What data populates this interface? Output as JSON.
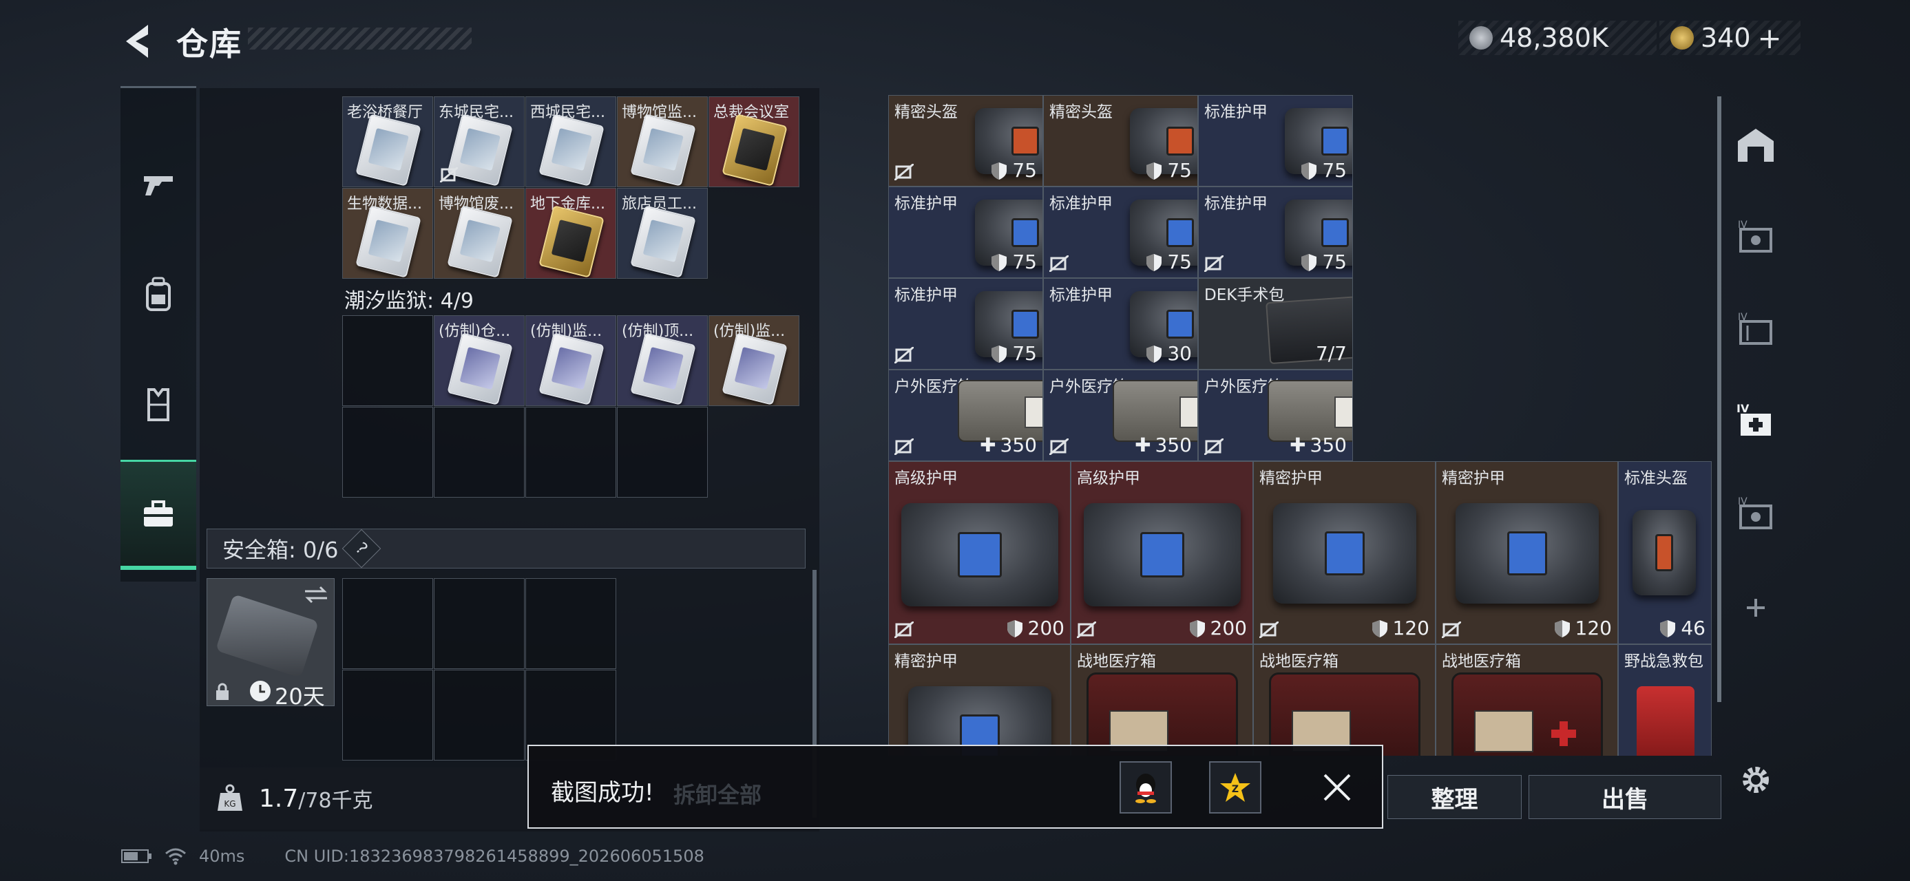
{
  "header": {
    "title": "仓库",
    "currency_1": "48,380K",
    "currency_2": "340",
    "currency_2_plus": "+"
  },
  "left_nav": [
    "gun-icon",
    "backpack-icon",
    "vest-icon",
    "toolbox-icon"
  ],
  "keycards_row1": [
    "老浴桥餐厅",
    "东城民宅...",
    "西城民宅...",
    "博物馆监...",
    "总裁会议室"
  ],
  "keycards_row2": [
    "生物数据...",
    "博物馆废...",
    "地下金库...",
    "旅店员工..."
  ],
  "prison_label": "潮汐监狱: 4/9",
  "prison_cards": [
    "(仿制)仓...",
    "(仿制)监...",
    "(仿制)顶...",
    "(仿制)监..."
  ],
  "safe": {
    "label": "安全箱: 0/6",
    "help": "?",
    "duration": "20天"
  },
  "weight": {
    "current": "1.7",
    "max": "/78千克"
  },
  "items": {
    "r1": [
      {
        "name": "精密头盔",
        "value": "75"
      },
      {
        "name": "精密头盔",
        "value": "75"
      },
      {
        "name": "标准护甲",
        "value": "75"
      }
    ],
    "r2": [
      {
        "name": "标准护甲",
        "value": "75"
      },
      {
        "name": "标准护甲",
        "value": "75"
      },
      {
        "name": "标准护甲",
        "value": "75"
      }
    ],
    "r3": [
      {
        "name": "标准护甲",
        "value": "75"
      },
      {
        "name": "标准护甲",
        "value": "30"
      },
      {
        "name": "DEK手术包",
        "value": "7/7"
      }
    ],
    "r4": [
      {
        "name": "户外医疗箱",
        "value": "350"
      },
      {
        "name": "户外医疗箱",
        "value": "350"
      },
      {
        "name": "户外医疗箱",
        "value": "350"
      }
    ],
    "r5": [
      {
        "name": "高级护甲",
        "value": "200"
      },
      {
        "name": "高级护甲",
        "value": "200"
      },
      {
        "name": "精密护甲",
        "value": "120"
      },
      {
        "name": "精密护甲",
        "value": "120"
      },
      {
        "name": "标准头盔",
        "value": "46"
      }
    ],
    "r6": [
      {
        "name": "精密护甲"
      },
      {
        "name": "战地医疗箱"
      },
      {
        "name": "战地医疗箱"
      },
      {
        "name": "战地医疗箱"
      },
      {
        "name": "野战急救包"
      }
    ]
  },
  "toast": {
    "message": "截图成功!",
    "behind_text": "拆卸全部"
  },
  "buttons": {
    "sort": "整理",
    "sell": "出售"
  },
  "status": {
    "ping": "40ms",
    "uid": "CN UID:18323698379826145889​9_202606051508"
  },
  "colors": {
    "accent": "#46d6a4"
  }
}
